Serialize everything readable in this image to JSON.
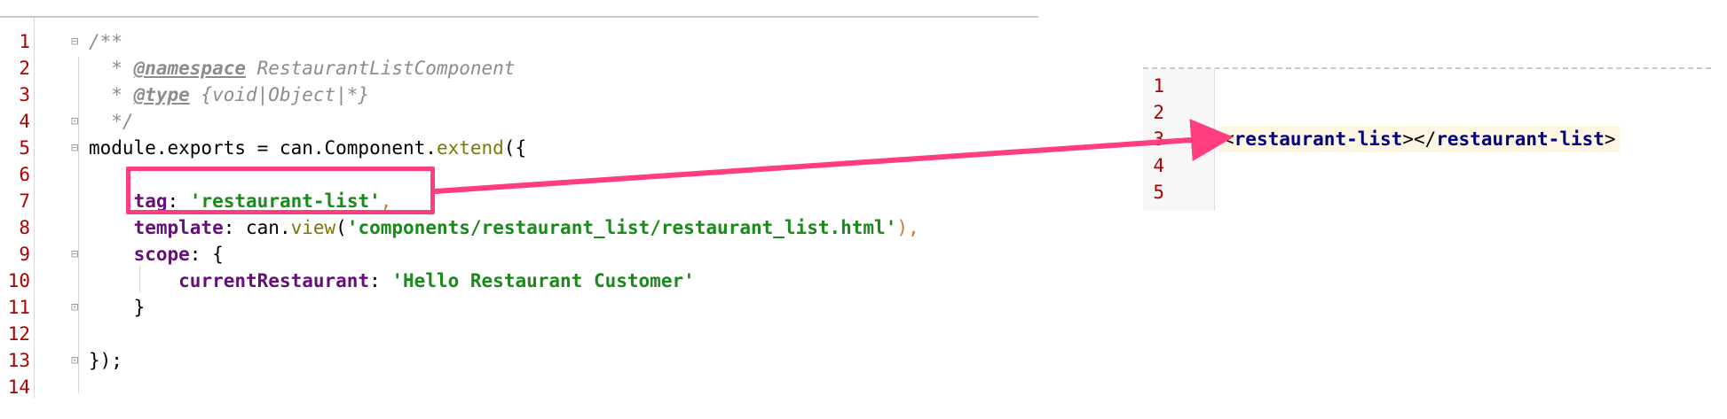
{
  "left_editor": {
    "lines": [
      {
        "n": "1",
        "segments": [
          {
            "t": "/**",
            "c": "c-comment"
          }
        ]
      },
      {
        "n": "2",
        "segments": [
          {
            "t": "  * ",
            "c": "c-comment"
          },
          {
            "t": "@namespace",
            "c": "c-tag"
          },
          {
            "t": " RestaurantListComponent",
            "c": "c-comment"
          }
        ]
      },
      {
        "n": "3",
        "segments": [
          {
            "t": "  * ",
            "c": "c-comment"
          },
          {
            "t": "@type",
            "c": "c-tag"
          },
          {
            "t": " {void|Object|*}",
            "c": "c-comment"
          }
        ]
      },
      {
        "n": "4",
        "segments": [
          {
            "t": "  */",
            "c": "c-comment"
          }
        ]
      },
      {
        "n": "5",
        "segments": [
          {
            "t": "module.exports = can.Component.",
            "c": "c-plain"
          },
          {
            "t": "extend",
            "c": "c-fn"
          },
          {
            "t": "({",
            "c": "c-plain"
          }
        ]
      },
      {
        "n": "6",
        "segments": []
      },
      {
        "n": "7",
        "segments": [
          {
            "t": "    ",
            "c": "c-plain"
          },
          {
            "t": "tag",
            "c": "c-key"
          },
          {
            "t": ": ",
            "c": "c-plain"
          },
          {
            "t": "'restaurant-list'",
            "c": "c-str"
          },
          {
            "t": ",",
            "c": "c-punc"
          }
        ]
      },
      {
        "n": "8",
        "segments": [
          {
            "t": "    ",
            "c": "c-plain"
          },
          {
            "t": "template",
            "c": "c-key"
          },
          {
            "t": ": can.",
            "c": "c-plain"
          },
          {
            "t": "view",
            "c": "c-fn"
          },
          {
            "t": "(",
            "c": "c-plain"
          },
          {
            "t": "'components/restaurant_list/restaurant_list.html'",
            "c": "c-str"
          },
          {
            "t": "),",
            "c": "c-punc"
          }
        ]
      },
      {
        "n": "9",
        "segments": [
          {
            "t": "    ",
            "c": "c-plain"
          },
          {
            "t": "scope",
            "c": "c-key"
          },
          {
            "t": ": {",
            "c": "c-plain"
          }
        ]
      },
      {
        "n": "10",
        "segments": [
          {
            "t": "        ",
            "c": "c-plain"
          },
          {
            "t": "currentRestaurant",
            "c": "c-key"
          },
          {
            "t": ": ",
            "c": "c-plain"
          },
          {
            "t": "'Hello Restaurant Customer'",
            "c": "c-str"
          }
        ]
      },
      {
        "n": "11",
        "segments": [
          {
            "t": "    }",
            "c": "c-plain"
          }
        ]
      },
      {
        "n": "12",
        "segments": []
      },
      {
        "n": "13",
        "segments": [
          {
            "t": "});",
            "c": "c-plain"
          }
        ]
      },
      {
        "n": "14",
        "segments": []
      }
    ],
    "fold_lines": [
      "1",
      "4",
      "5",
      "9",
      "11",
      "13"
    ]
  },
  "right_editor": {
    "lines": [
      {
        "n": "1",
        "html": null
      },
      {
        "n": "2",
        "html": null
      },
      {
        "n": "3",
        "html": {
          "open": "<",
          "name": "restaurant-list",
          "close_open": "></",
          "close_name": "restaurant-list",
          "end": ">"
        }
      },
      {
        "n": "4",
        "html": null
      },
      {
        "n": "5",
        "html": null
      }
    ]
  },
  "colors": {
    "highlight": "#ff3d7f",
    "line_number": "#b00000"
  }
}
